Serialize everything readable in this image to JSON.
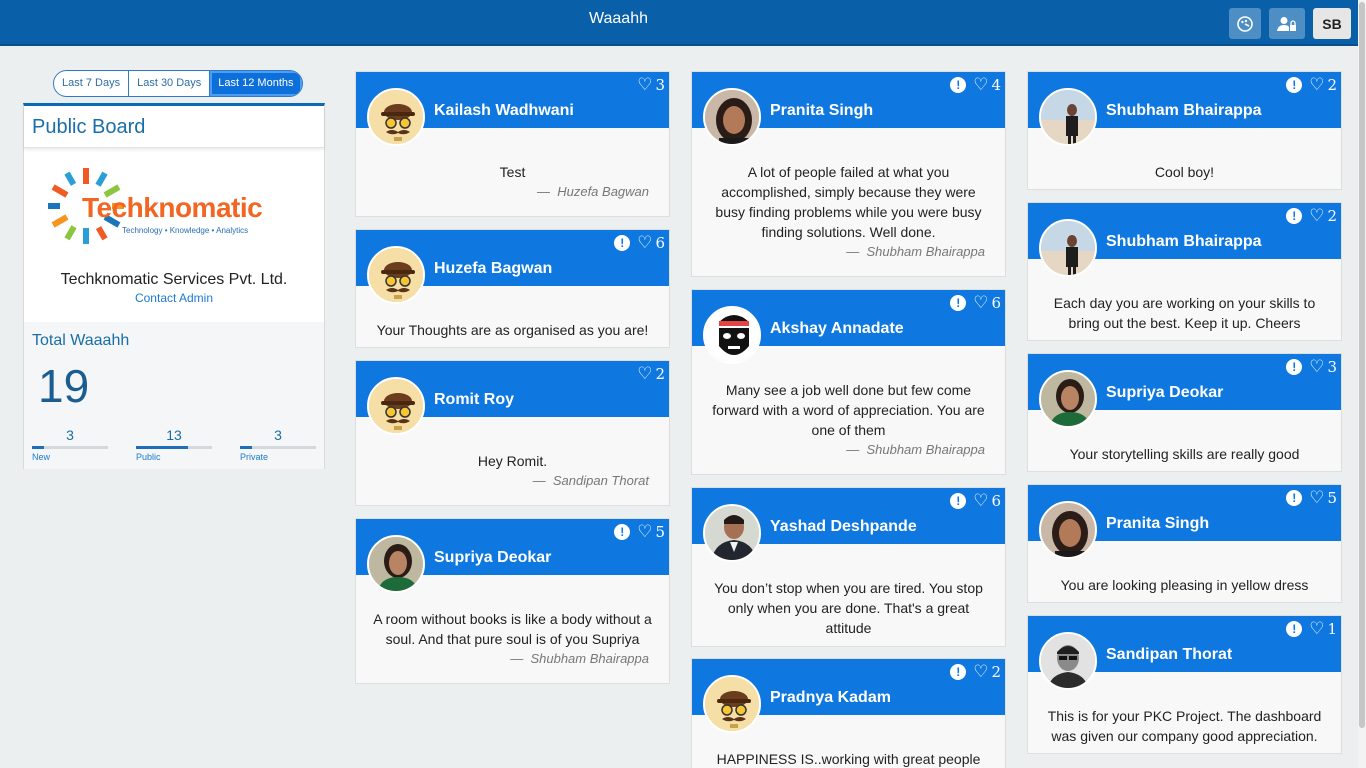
{
  "app": {
    "title": "Waaahh",
    "user_initials": "SB"
  },
  "range": {
    "options": [
      "Last 7 Days",
      "Last 30 Days",
      "Last 12 Months"
    ],
    "active_index": 2
  },
  "board": {
    "title": "Public Board",
    "logo_text": "Techknomatic",
    "logo_tagline": "Technology • Knowledge • Analytics",
    "company": "Techknomatic Services Pvt. Ltd.",
    "contact": "Contact Admin",
    "total_label": "Total Waaahh",
    "total": "19",
    "stats": [
      {
        "value": "3",
        "label": "New",
        "fraction": 0.16
      },
      {
        "value": "13",
        "label": "Public",
        "fraction": 0.68
      },
      {
        "value": "3",
        "label": "Private",
        "fraction": 0.16
      }
    ]
  },
  "cards": [
    {
      "name": "Kailash Wadhwani",
      "flag": false,
      "likes": "3",
      "avatar": "mustache",
      "message": "Test",
      "from": "Huzefa Bagwan"
    },
    {
      "name": "Huzefa Bagwan",
      "flag": true,
      "likes": "6",
      "avatar": "mustache",
      "message": "Your Thoughts are as organised as you are!",
      "from": ""
    },
    {
      "name": "Romit Roy",
      "flag": false,
      "likes": "2",
      "avatar": "mustache",
      "message": "Hey Romit.",
      "from": "Sandipan Thorat"
    },
    {
      "name": "Supriya Deokar",
      "flag": true,
      "likes": "5",
      "avatar": "photo-woman-green",
      "message": "A room without books is like a body without a soul. And that pure soul is of you Supriya",
      "from": "Shubham Bhairappa"
    },
    {
      "name": "Pranita Singh",
      "flag": true,
      "likes": "4",
      "avatar": "photo-woman",
      "message": "A lot of people failed at what you accomplished, simply because they were busy finding problems while you were busy finding solutions. Well done.",
      "from": "Shubham Bhairappa"
    },
    {
      "name": "Akshay Annadate",
      "flag": true,
      "likes": "6",
      "avatar": "mask",
      "message": "Many see a job well done but few come forward with a word of appreciation. You are one of them",
      "from": "Shubham Bhairappa"
    },
    {
      "name": "Yashad Deshpande",
      "flag": true,
      "likes": "6",
      "avatar": "photo-man-suit",
      "message": "You don’t stop when you are tired. You stop only when you are done. That's a great attitude",
      "from": ""
    },
    {
      "name": "Pradnya Kadam",
      "flag": true,
      "likes": "2",
      "avatar": "mustache",
      "message": "HAPPINESS IS..working with great people",
      "from": ""
    },
    {
      "name": "Shubham Bhairappa",
      "flag": true,
      "likes": "2",
      "avatar": "photo-beach",
      "message": "Cool boy!",
      "from": ""
    },
    {
      "name": "Shubham Bhairappa",
      "flag": true,
      "likes": "2",
      "avatar": "photo-beach",
      "message": "Each day you are working on your skills to bring out the best. Keep it up. Cheers",
      "from": ""
    },
    {
      "name": "Supriya Deokar",
      "flag": true,
      "likes": "3",
      "avatar": "photo-woman-green",
      "message": "Your storytelling skills are really good",
      "from": ""
    },
    {
      "name": "Pranita Singh",
      "flag": true,
      "likes": "5",
      "avatar": "photo-woman",
      "message": "You are looking pleasing in yellow dress",
      "from": ""
    },
    {
      "name": "Sandipan Thorat",
      "flag": true,
      "likes": "1",
      "avatar": "photo-bw",
      "message": "This is for your PKC Project. The dashboard was given our company good appreciation.",
      "from": ""
    }
  ]
}
